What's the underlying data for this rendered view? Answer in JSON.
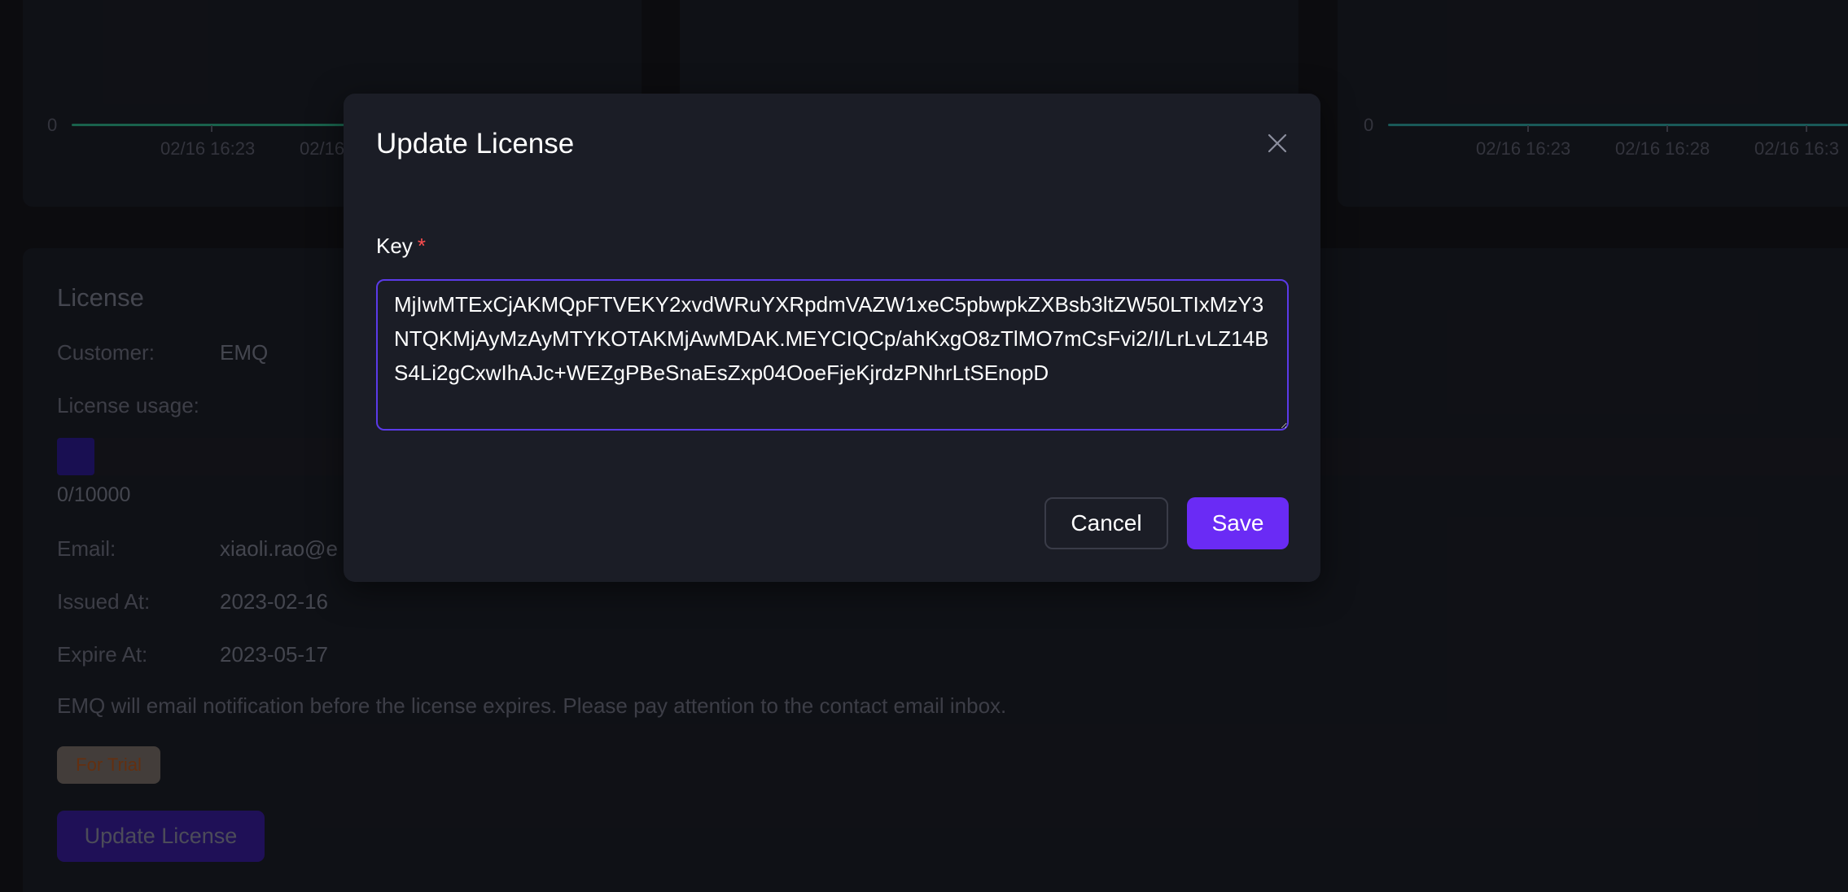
{
  "charts": [
    {
      "zero_label": "0",
      "x_labels": [
        "02/16 16:23",
        "02/16"
      ]
    },
    {
      "zero_label": "0",
      "x_labels": [
        "02/16 16:23",
        "02/16 16:28",
        "02/16 16:3"
      ]
    }
  ],
  "license": {
    "title": "License",
    "customer_label": "Customer:",
    "customer_value": "EMQ",
    "usage_label": "License usage:",
    "usage_value": "0/10000",
    "usage_fraction": 0.0,
    "email_label": "Email:",
    "email_value": "xiaoli.rao@e",
    "issued_label": "Issued At:",
    "issued_value": "2023-02-16",
    "expire_label": "Expire At:",
    "expire_value": "2023-05-17",
    "notice": "EMQ will email notification before the license expires. Please pay attention to the contact email inbox.",
    "trial_badge": "For Trial",
    "update_button": "Update License"
  },
  "dialog": {
    "title": "Update License",
    "key_label": "Key",
    "required_mark": "*",
    "key_value": "MjIwMTExCjAKMQpFTVEKY2xvdWRuYXRpdmVAZW1xeC5pbwpkZXBsb3ltZW50LTIxMzY3NTQKMjAyMzAyMTYKOTAKMjAwMDAK.MEYCIQCp/ahKxgO8zTlMO7mCsFvi2/I/LrLvLZ14BS4Li2gCxwIhAJc+WEZgPBeSnaEsZxp04OoeFjeKjrdzPNhrLtSEnopD",
    "cancel_label": "Cancel",
    "save_label": "Save",
    "close_icon": "close-icon"
  },
  "colors": {
    "accent": "#6a2bf5",
    "required": "#ff4d4f",
    "chart_line": "#2fb38a"
  }
}
